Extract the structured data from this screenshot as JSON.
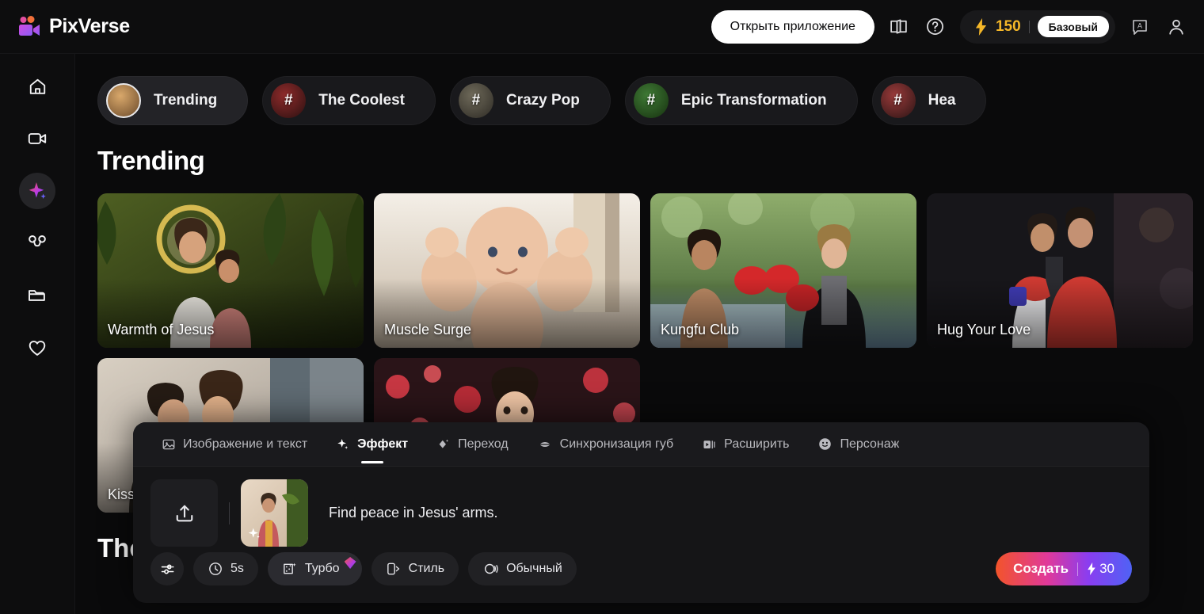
{
  "header": {
    "brand": "PixVerse",
    "open_app_label": "Открыть приложение",
    "book_icon": "book-icon",
    "help_icon": "help-circle-icon",
    "credits_value": "150",
    "plan_label": "Базовый",
    "translate_icon": "translate-icon",
    "account_icon": "account-icon",
    "credits_color": "#f5b728"
  },
  "sidebar": {
    "items": [
      {
        "name": "home",
        "icon": "home-icon",
        "active": false
      },
      {
        "name": "video",
        "icon": "video-camera-icon",
        "active": false
      },
      {
        "name": "effects",
        "icon": "sparkle-icon",
        "active": true
      },
      {
        "name": "character",
        "icon": "mouse-head-icon",
        "active": false
      },
      {
        "name": "assets",
        "icon": "folder-icon",
        "active": false
      },
      {
        "name": "favorites",
        "icon": "heart-icon",
        "active": false
      }
    ]
  },
  "categories": [
    {
      "label": "Trending",
      "avatar": "photo-avatar",
      "hash": false,
      "active": true,
      "c1": "#d9a86b",
      "c2": "#6b4a2a"
    },
    {
      "label": "The Coolest",
      "avatar": "hash-avatar",
      "hash": true,
      "active": false,
      "c1": "#8f2b2b",
      "c2": "#2a1010"
    },
    {
      "label": "Crazy Pop",
      "avatar": "hash-avatar",
      "hash": true,
      "active": false,
      "c1": "#6f6a5a",
      "c2": "#2d2a24"
    },
    {
      "label": "Epic Transformation",
      "avatar": "hash-avatar",
      "hash": true,
      "active": false,
      "c1": "#3f7a35",
      "c2": "#16310f"
    },
    {
      "label": "Hea",
      "avatar": "hash-avatar",
      "hash": true,
      "active": false,
      "c1": "#9a3a3a",
      "c2": "#2a1414"
    }
  ],
  "main": {
    "section_title": "Trending",
    "section_title_2": "The",
    "cards": [
      {
        "label": "Warmth of Jesus",
        "art": "jesus"
      },
      {
        "label": "Muscle Surge",
        "art": "baby"
      },
      {
        "label": "Kungfu Club",
        "art": "boxing"
      },
      {
        "label": "Hug Your Love",
        "art": "hug"
      },
      {
        "label": "Kiss",
        "art": "kiss"
      },
      {
        "label": "",
        "art": "petals"
      }
    ]
  },
  "panel": {
    "tabs": [
      {
        "label": "Изображение и текст",
        "icon": "image-icon",
        "active": false
      },
      {
        "label": "Эффект",
        "icon": "sparkle-icon",
        "active": true
      },
      {
        "label": "Переход",
        "icon": "transition-diamond-icon",
        "active": false
      },
      {
        "label": "Синхронизация губ",
        "icon": "lips-icon",
        "active": false
      },
      {
        "label": "Расширить",
        "icon": "expand-video-icon",
        "active": false
      },
      {
        "label": "Персонаж",
        "icon": "smiley-icon",
        "active": false
      }
    ],
    "upload_icon": "upload-icon",
    "reference_thumb": "reference-image",
    "prompt": "Find peace in Jesus' arms.",
    "controls": [
      {
        "label": "",
        "icon": "sliders-icon",
        "round": true,
        "highlight": false,
        "gem": false
      },
      {
        "label": "5s",
        "icon": "clock-icon",
        "round": false,
        "highlight": false,
        "gem": false
      },
      {
        "label": "Турбо",
        "icon": "turbo-icon",
        "round": false,
        "highlight": true,
        "gem": true
      },
      {
        "label": "Стиль",
        "icon": "style-icon",
        "round": false,
        "highlight": false,
        "gem": false
      },
      {
        "label": "Обычный",
        "icon": "mode-icon",
        "round": false,
        "highlight": false,
        "gem": false
      }
    ],
    "create_label": "Создать",
    "create_cost": "30",
    "create_gradient": "linear-gradient(90deg,#f2542a,#e0399a,#8a3df0,#4f62f5)"
  }
}
